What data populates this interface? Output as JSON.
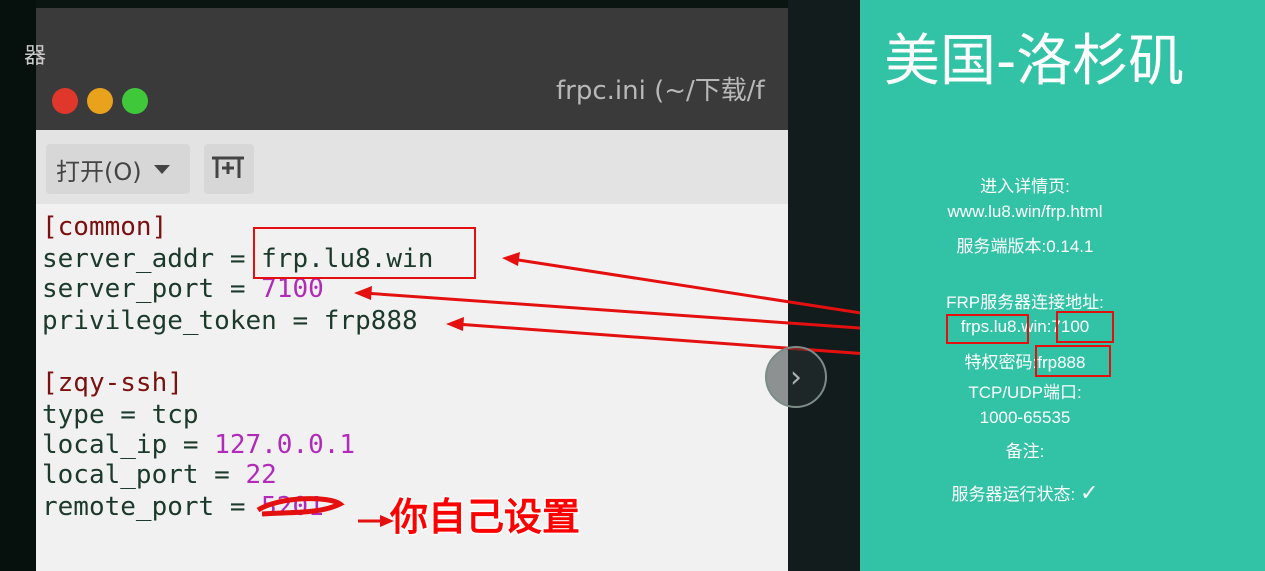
{
  "editor_window": {
    "app_label": "器",
    "title": "frpc.ini (~/下载/f",
    "toolbar": {
      "open_label": "打开(O)",
      "pin_icon": "pin-icon"
    },
    "lines": [
      {
        "key": "[common]",
        "type": "section"
      },
      {
        "key": "server_addr",
        "sep": " = ",
        "value": "frp.lu8.win",
        "vtype": "text"
      },
      {
        "key": "server_port",
        "sep": " = ",
        "value": "7100",
        "vtype": "num"
      },
      {
        "key": "privilege_token",
        "sep": " = ",
        "value": "frp888",
        "vtype": "text"
      },
      {
        "key": "",
        "type": "blank"
      },
      {
        "key": "[zqy-ssh]",
        "type": "section"
      },
      {
        "key": "type",
        "sep": " = ",
        "value": "tcp",
        "vtype": "text"
      },
      {
        "key": "local_ip",
        "sep": " = ",
        "value": "127.0.0.1",
        "vtype": "num"
      },
      {
        "key": "local_port",
        "sep": " = ",
        "value": "22",
        "vtype": "num"
      },
      {
        "key": "remote_port",
        "sep": " = ",
        "value": "5201",
        "vtype": "num"
      }
    ]
  },
  "annotation": {
    "text": "你自己设置",
    "color": "#ff0000"
  },
  "panel": {
    "title": "美国-洛杉矶",
    "detail_label": "进入详情页:",
    "detail_url": "www.lu8.win/frp.html",
    "server_version": "服务端版本:0.14.1",
    "connect_label": "FRP服务器连接地址:",
    "connect_address": "frps.lu8.win:7100",
    "token": "特权密码:frp888",
    "ports_label": "TCP/UDP端口:",
    "ports_range": "1000-65535",
    "notes_label": "备注:",
    "status_label": "服务器运行状态:",
    "status_value": "✓",
    "bg_color": "#32c3a6"
  },
  "nav": {
    "next_icon": "chevron-right-icon"
  }
}
